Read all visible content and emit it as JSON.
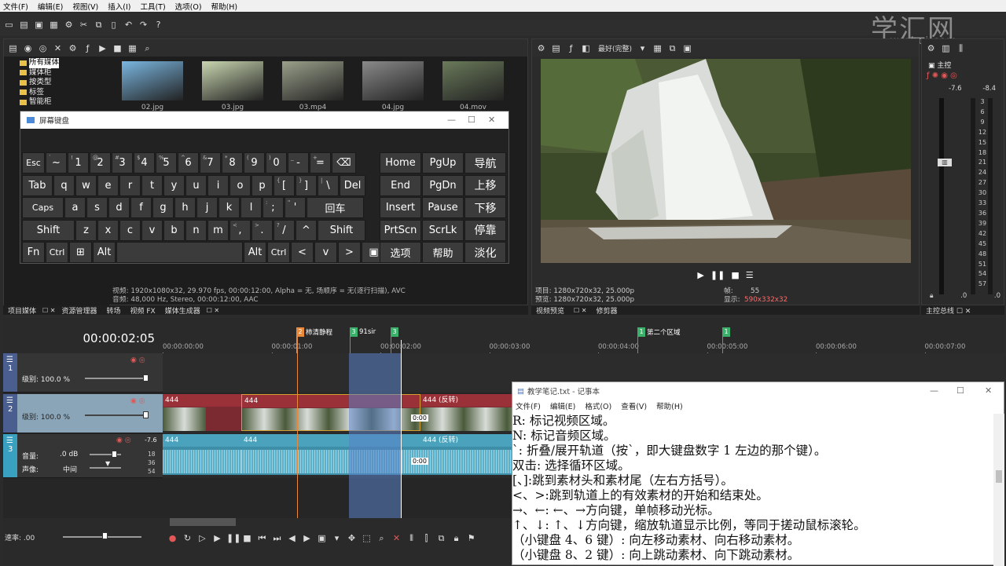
{
  "menu": [
    "文件(F)",
    "编辑(E)",
    "视图(V)",
    "插入(I)",
    "工具(T)",
    "选项(O)",
    "帮助(H)"
  ],
  "watermark": {
    "brand": "学汇网",
    "url": "xuehui.com"
  },
  "media_tree": [
    "所有媒体",
    "媒体柜",
    "按类型",
    "标签",
    "智能柜"
  ],
  "thumbs": [
    {
      "name": "02.jpg",
      "color": "#7ab6e0"
    },
    {
      "name": "03.jpg",
      "color": "#c9d6b0"
    },
    {
      "name": "03.mp4",
      "color": "#9aa08a"
    },
    {
      "name": "04.jpg",
      "color": "#8a8a8a"
    },
    {
      "name": "04.mov",
      "color": "#6a7a5a"
    }
  ],
  "osk": {
    "title": "屏幕键盘",
    "rows": [
      [
        {
          "t": "Esc",
          "w": 28,
          "s": 1
        },
        {
          "t": "~",
          "sup": "`",
          "w": 26
        },
        {
          "t": "1",
          "sup": "!",
          "w": 26
        },
        {
          "t": "2",
          "sup": "@",
          "w": 26
        },
        {
          "t": "3",
          "sup": "#",
          "w": 26
        },
        {
          "t": "4",
          "sup": "$",
          "w": 26
        },
        {
          "t": "5",
          "sup": "%",
          "w": 26
        },
        {
          "t": "6",
          "sup": "^",
          "w": 26
        },
        {
          "t": "7",
          "sup": "&",
          "w": 26
        },
        {
          "t": "8",
          "sup": "*",
          "w": 26
        },
        {
          "t": "9",
          "sup": "(",
          "w": 26
        },
        {
          "t": "0",
          "sup": ")",
          "w": 26
        },
        {
          "t": "-",
          "sup": "_",
          "w": 26
        },
        {
          "t": "=",
          "sup": "+",
          "w": 26
        },
        {
          "t": "⌫",
          "w": 30
        }
      ],
      [
        {
          "t": "Tab",
          "w": 38
        },
        {
          "t": "q",
          "w": 26
        },
        {
          "t": "w",
          "w": 26
        },
        {
          "t": "e",
          "w": 26
        },
        {
          "t": "r",
          "w": 26
        },
        {
          "t": "t",
          "w": 26
        },
        {
          "t": "y",
          "w": 26
        },
        {
          "t": "u",
          "w": 26
        },
        {
          "t": "i",
          "w": 26
        },
        {
          "t": "o",
          "w": 26
        },
        {
          "t": "p",
          "w": 26
        },
        {
          "t": "[",
          "sup": "{",
          "w": 26
        },
        {
          "t": "]",
          "sup": "}",
          "w": 26
        },
        {
          "t": "\\",
          "sup": "|",
          "w": 26
        },
        {
          "t": "Del",
          "w": 32
        }
      ],
      [
        {
          "t": "Caps",
          "w": 52,
          "s": 1
        },
        {
          "t": "a",
          "w": 26
        },
        {
          "t": "s",
          "w": 26
        },
        {
          "t": "d",
          "w": 26
        },
        {
          "t": "f",
          "w": 26
        },
        {
          "t": "g",
          "w": 26
        },
        {
          "t": "h",
          "w": 26
        },
        {
          "t": "j",
          "w": 26
        },
        {
          "t": "k",
          "w": 26
        },
        {
          "t": "l",
          "w": 26
        },
        {
          "t": ";",
          "sup": ":",
          "w": 26
        },
        {
          "t": "'",
          "sup": "\"",
          "w": 26
        },
        {
          "t": "回车",
          "w": 72
        }
      ],
      [
        {
          "t": "Shift",
          "w": 66
        },
        {
          "t": "z",
          "w": 26
        },
        {
          "t": "x",
          "w": 26
        },
        {
          "t": "c",
          "w": 26
        },
        {
          "t": "v",
          "w": 26
        },
        {
          "t": "b",
          "w": 26
        },
        {
          "t": "n",
          "w": 26
        },
        {
          "t": "m",
          "w": 26
        },
        {
          "t": ",",
          "sup": "<",
          "w": 26
        },
        {
          "t": ".",
          "sup": ">",
          "w": 26
        },
        {
          "t": "/",
          "sup": "?",
          "w": 26
        },
        {
          "t": "^",
          "w": 26
        },
        {
          "t": "Shift",
          "w": 60
        }
      ],
      [
        {
          "t": "Fn",
          "w": 28
        },
        {
          "t": "Ctrl",
          "w": 28,
          "s": 1
        },
        {
          "t": "⊞",
          "w": 28
        },
        {
          "t": "Alt",
          "w": 28
        },
        {
          "t": "",
          "w": 160
        },
        {
          "t": "Alt",
          "w": 28
        },
        {
          "t": "Ctrl",
          "w": 28,
          "s": 1
        },
        {
          "t": "<",
          "w": 28
        },
        {
          "t": "v",
          "w": 28
        },
        {
          "t": ">",
          "w": 28
        },
        {
          "t": "▣",
          "w": 30
        }
      ]
    ],
    "right": [
      [
        "Home",
        "PgUp",
        "导航"
      ],
      [
        "End",
        "PgDn",
        "上移"
      ],
      [
        "Insert",
        "Pause",
        "下移"
      ],
      [
        "PrtScn",
        "ScrLk",
        "停靠"
      ],
      [
        "选项",
        "帮助",
        "淡化"
      ]
    ]
  },
  "media_info": [
    "视频: 1920x1080x32, 29.970 fps, 00:00:12:00, Alpha = 无, 场顺序 = 无(逐行扫描), AVC",
    "音频: 48,000 Hz, Stereo, 00:00:12:00, AAC"
  ],
  "panel_tabs": [
    "项目媒体",
    "资源管理器",
    "转场",
    "视频 FX",
    "媒体生成器"
  ],
  "preview": {
    "quality": "最好(完整)",
    "info_left": [
      "项目: 1280x720x32, 25.000p",
      "预览: 1280x720x32, 25.000p"
    ],
    "frame_label": "帧:",
    "frame_value": "55",
    "display_label": "显示:",
    "display_value": "590x332x32",
    "tabs": [
      "视频预览",
      "修剪器"
    ]
  },
  "master": {
    "title": "主控",
    "l": "-7.6",
    "r": "-8.4",
    "scale": [
      "3",
      "6",
      "9",
      "12",
      "15",
      "18",
      "21",
      "24",
      "27",
      "30",
      "33",
      "36",
      "39",
      "42",
      "45",
      "48",
      "51",
      "54",
      "57"
    ],
    "bottom": [
      ".0",
      ".0"
    ],
    "tab": "主控总线"
  },
  "timeline": {
    "time": "00:00:02:05",
    "ticks": [
      "00:00:00:00",
      "00:00:01:00",
      "00:00:02:00",
      "00:00:03:00",
      "00:00:04:00",
      "00:00:05:00",
      "00:00:06:00",
      "00:00:07:00"
    ],
    "markers": [
      {
        "n": "2",
        "label": "柿清静程",
        "c": "#e88a3a"
      },
      {
        "n": "3",
        "label": "91sir",
        "c": "#3bb06a"
      },
      {
        "n": "3",
        "label": "",
        "c": "#3bb06a"
      },
      {
        "n": "1",
        "label": "第二个区域",
        "c": "#3bb06a"
      },
      {
        "n": "1",
        "label": "",
        "c": "#3bb06a"
      }
    ],
    "track1": {
      "num": "1",
      "level": "级别: 100.0 %"
    },
    "track2": {
      "num": "2",
      "level": "级别: 100.0 %",
      "clips": [
        "444",
        "444",
        "444 (反转)"
      ],
      "tc": "0:00"
    },
    "track3": {
      "num": "3",
      "vol_label": "音量:",
      "vol": ".0 dB",
      "pan_label": "声像:",
      "pan": "中间",
      "db": "-7.6",
      "scale": [
        "18",
        "36",
        "54"
      ],
      "clips": [
        "444",
        "444",
        "444 (反转)"
      ],
      "tc": "0:00"
    },
    "rate": "速率: .00"
  },
  "notepad": {
    "title": "教学笔记.txt - 记事本",
    "menu": [
      "文件(F)",
      "编辑(E)",
      "格式(O)",
      "查看(V)",
      "帮助(H)"
    ],
    "lines": [
      "R: 标记视频区域。",
      "N: 标记音频区域。",
      "`: 折叠/展开轨道（按`，即大键盘数字 1 左边的那个键）。",
      "双击: 选择循环区域。",
      "[、]:跳到素材头和素材尾（左右方括号）。",
      "<、>:跳到轨道上的有效素材的开始和结束处。",
      "→、←: ←、→方向键，单帧移动光标。",
      "↑、↓: ↑、↓方向键，缩放轨道显示比例，等同于搓动鼠标滚轮。",
      "（小键盘 4、6 键）: 向左移动素材、向右移动素材。",
      "（小键盘 8、2 键）: 向上跳动素材、向下跳动素材。"
    ]
  }
}
